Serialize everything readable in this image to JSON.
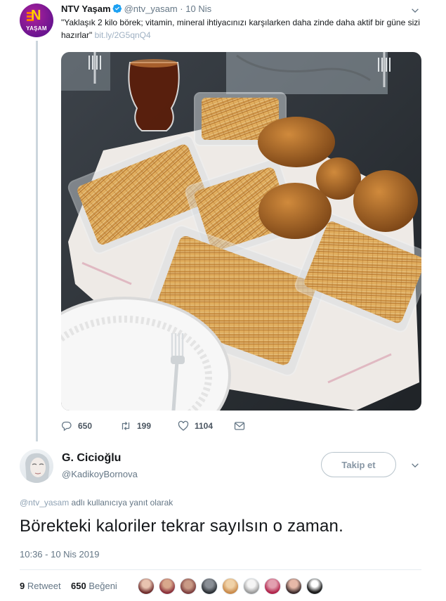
{
  "quoted_tweet": {
    "avatar_text": "YAŞAM",
    "avatar_letter": "N",
    "name": "NTV Yaşam",
    "handle": "@ntv_yasam",
    "separator": "·",
    "date": "10 Nis",
    "text": "\"Yaklaşık 2 kilo börek; vitamin, mineral ihtiyacınızı karşılarken daha zinde daha aktif bir güne sizi hazırlar\"",
    "link": "bit.ly/2G5qnQ4",
    "actions": {
      "replies": "650",
      "retweets": "199",
      "likes": "1104"
    }
  },
  "reply_tweet": {
    "name": "G. Cicioğlu",
    "handle": "@KadikoyBornova",
    "follow_label": "Takip et",
    "reply_to_handle": "@ntv_yasam",
    "reply_to_suffix": " adlı kullanıcıya yanıt olarak",
    "text": "Börekteki kaloriler tekrar sayılsın o zaman.",
    "timestamp": "10:36 - 10 Nis 2019",
    "retweet_count": "9",
    "retweet_label": "Retweet",
    "like_count": "650",
    "like_label": "Beğeni"
  },
  "colors": {
    "accent": "#1da1f2",
    "muted": "#657786",
    "avatar_purple": "#8a1b9a"
  }
}
